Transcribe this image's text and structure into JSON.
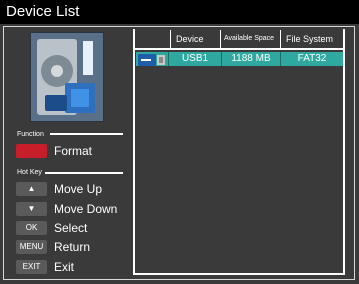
{
  "window": {
    "title": "Device List"
  },
  "icons": {
    "usb": "usb-drive-icon",
    "thumbnail": "hard-disk-image"
  },
  "sections": {
    "function_label": "Function",
    "hotkey_label": "Hot Key"
  },
  "legend": {
    "format": {
      "key": "",
      "label": "Format",
      "color": "#c81e2a"
    },
    "move_up": {
      "key": "▲",
      "label": "Move Up"
    },
    "move_down": {
      "key": "▼",
      "label": "Move Down"
    },
    "select": {
      "key": "OK",
      "label": "Select"
    },
    "return": {
      "key": "MENU",
      "label": "Return"
    },
    "exit": {
      "key": "EXIT",
      "label": "Exit"
    }
  },
  "table": {
    "columns": [
      "Device",
      "Available Space",
      "File System"
    ],
    "rows": [
      {
        "device": "USB1",
        "space": "1188 MB",
        "fs": "FAT32",
        "selected": true
      }
    ]
  },
  "colors": {
    "selected_row": "#2fa89f",
    "background": "#3a3a3a",
    "titlebar": "#000000"
  }
}
